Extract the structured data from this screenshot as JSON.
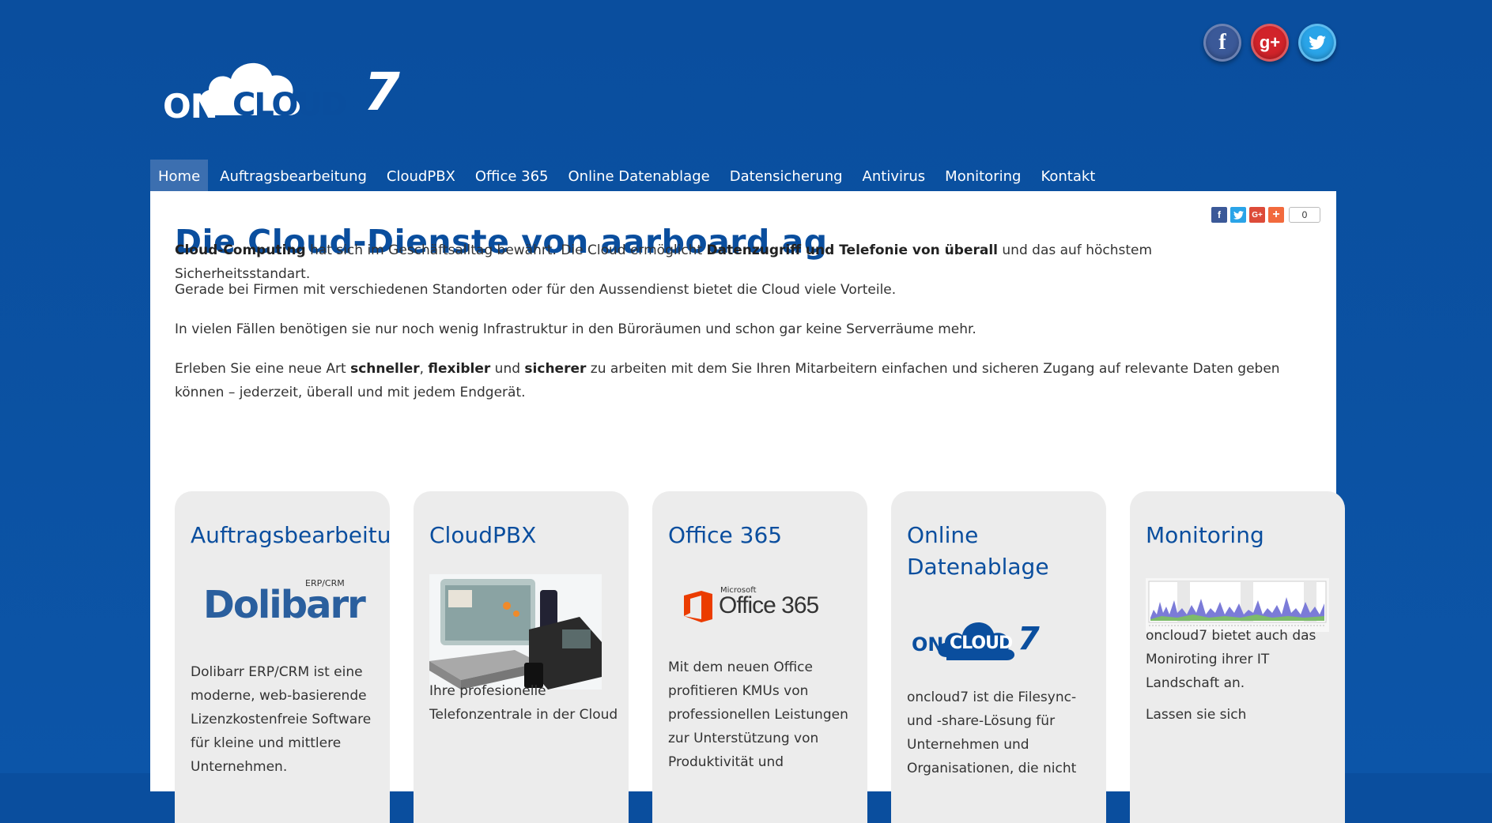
{
  "brand": {
    "logo_on": "ON",
    "logo_cloud": "CLOUD",
    "logo_seven": "7"
  },
  "social": [
    {
      "name": "facebook",
      "glyph": "f"
    },
    {
      "name": "google-plus",
      "glyph": "g+"
    },
    {
      "name": "twitter",
      "glyph": "t"
    }
  ],
  "nav": [
    "Home",
    "Auftragsbearbeitung",
    "CloudPBX",
    "Office 365",
    "Online Datenablage",
    "Datensicherung",
    "Antivirus",
    "Monitoring",
    "Kontakt"
  ],
  "share": {
    "count": "0"
  },
  "main": {
    "title": "Die Cloud-Dienste von aarboard ag",
    "p1_bold1": "Cloud-Computing",
    "p1_text1": " hat sich im Geschäftsalltag bewährt. Die Cloud ermöglicht ",
    "p1_bold2": "Datenzugriff und Telefonie von überall",
    "p1_text2": " und das auf höchstem Sicherheitsstandart.",
    "p2": "Gerade bei Firmen mit verschiedenen Standorten oder für den Aussendienst bietet die Cloud viele Vorteile.",
    "p3": "In vielen Fällen benötigen sie nur noch wenig Infrastruktur in den Büroräumen und schon gar keine Serverräume mehr.",
    "p4_text1": "Erleben Sie eine neue Art ",
    "p4_bold1": "schneller",
    "p4_text2": ", ",
    "p4_bold2": "flexibler",
    "p4_text3": " und ",
    "p4_bold3": "sicherer",
    "p4_text4": " zu arbeiten mit dem Sie Ihren Mitarbeitern einfachen und sicheren Zugang auf relevante Daten geben können – jederzeit, überall und mit jedem Endgerät."
  },
  "cards": [
    {
      "title": "Auftragsbearbeitung",
      "logo_text": "Dolibarr",
      "logo_sub": "ERP/CRM",
      "text": "Dolibarr ERP/CRM ist eine moderne, web-basierende Lizenzkostenfreie Software für kleine und mittlere Unternehmen."
    },
    {
      "title": "CloudPBX",
      "text": "Ihre profesionelle Telefonzentrale in der Cloud"
    },
    {
      "title": "Office 365",
      "logo_small": "Microsoft",
      "logo_text": "Office 365",
      "text": "Mit dem neuen Office profitieren KMUs von professionellen Leistungen zur Unterstützung von Produktivität und"
    },
    {
      "title": "Online Datenablage",
      "text": "oncloud7 ist die Filesync- und -share-Lösung für Unternehmen und Organisationen, die nicht"
    },
    {
      "title": "Monitoring",
      "text": "oncloud7 bietet auch das Moniroting ihrer IT Landschaft an.",
      "text2": "Lassen sie sich"
    }
  ]
}
